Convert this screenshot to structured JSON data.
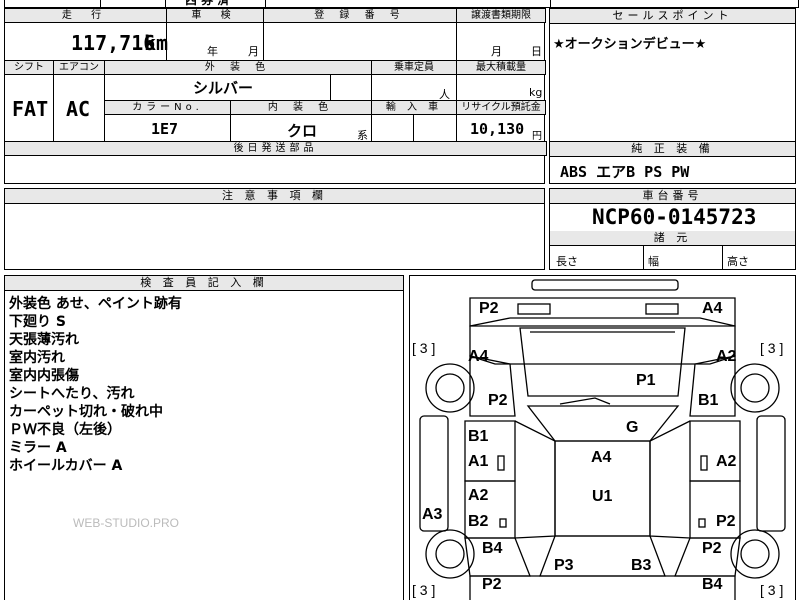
{
  "top_strip": {
    "partial_text": "西 券 済"
  },
  "mileage": {
    "header": "走 行",
    "value": "117,716",
    "unit": "km"
  },
  "inspection": {
    "header": "車 検",
    "year_unit": "年",
    "month_unit": "月"
  },
  "registration": {
    "header": "登 録 番 号"
  },
  "transfer": {
    "header": "譲渡書類期限",
    "month_unit": "月",
    "day_unit": "日"
  },
  "sales_point": {
    "header": "セールスポイント",
    "text": "★オークションデビュー★"
  },
  "shift": {
    "header": "シフト",
    "value": "FAT"
  },
  "aircon": {
    "header": "エアコン",
    "value": "AC"
  },
  "exterior_color": {
    "header": "外 装 色",
    "value": "シルバー"
  },
  "capacity": {
    "header": "乗車定員",
    "unit": "人"
  },
  "max_load": {
    "header": "最大積載量",
    "unit": "kg"
  },
  "color_no": {
    "header": "カラーNo.",
    "value": "1E7"
  },
  "interior_color": {
    "header": "内 装 色",
    "value": "クロ",
    "suffix": "系"
  },
  "import": {
    "header": "輸 入 車"
  },
  "recycle": {
    "header": "リサイクル預託金",
    "value": "10,130",
    "unit": "円"
  },
  "later_parts": {
    "header": "後日発送部品"
  },
  "equipment": {
    "header": "純 正 装 備",
    "value": "ABS エアB PS PW"
  },
  "caution": {
    "header": "注 意 事 項 欄"
  },
  "chassis": {
    "header": "車台番号",
    "value": "NCP60-0145723"
  },
  "dimensions": {
    "header": "諸 元",
    "length": "長さ",
    "width": "幅",
    "height": "高さ"
  },
  "inspector": {
    "header": "検 査 員 記 入 欄",
    "notes": [
      "外装色 あせ、ペイント跡有",
      "下廻り S",
      "天張薄汚れ",
      "室内汚れ",
      "室内内張傷",
      "シートへたり、汚れ",
      "カーペット切れ・破れ中",
      "ＰＷ不良（左後）",
      "ミラー A",
      "ホイールカバー A"
    ],
    "watermark": "WEB-STUDIO.PRO"
  },
  "diagram": {
    "tire_tread": "3",
    "labels": {
      "front_left_bumper": "P2",
      "front_right_bumper": "A4",
      "left_front_fender": "A4",
      "right_front_fender": "A2",
      "hood": "P1",
      "left_fender_lower": "P2",
      "right_fender_lower": "B1",
      "windshield": "G",
      "left_front_door_upper": "B1",
      "left_front_door_lower": "A1",
      "right_front_door_small": "A2",
      "roof": "A4",
      "left_rear_door_upper": "A2",
      "left_rear_door_lower": "B2",
      "right_rear_door": "P2",
      "roof_lower": "U1",
      "left_sill": "A3",
      "left_rear_fender": "B4",
      "right_rear_fender": "P2",
      "rear_left": "P3",
      "rear_right": "B3",
      "rear_bumper_left": "P2",
      "rear_bumper_right": "B4"
    }
  }
}
